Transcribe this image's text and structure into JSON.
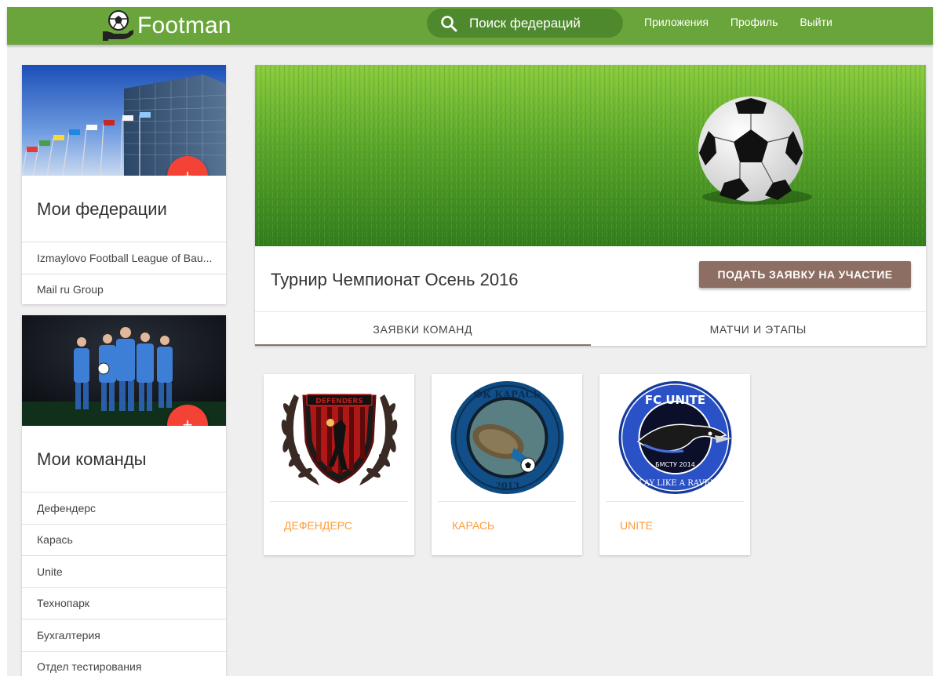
{
  "app": {
    "name": "Footman"
  },
  "header": {
    "search_placeholder": "Поиск федераций",
    "nav": [
      "Приложения",
      "Профиль",
      "Выйти"
    ]
  },
  "federations": {
    "title": "Мои федерации",
    "items": [
      "Izmaylovo Football League of Bau...",
      "Mail ru Group"
    ],
    "add_label": "+"
  },
  "teams": {
    "title": "Мои команды",
    "items": [
      "Дефендерс",
      "Карась",
      "Unite",
      "Технопарк",
      "Бухгалтерия",
      "Отдел тестирования"
    ],
    "add_label": "+"
  },
  "tournament": {
    "title": "Турнир Чемпионат Осень 2016",
    "apply_label": "ПОДАТЬ ЗАЯВКУ НА УЧАСТИЕ",
    "tabs": [
      "ЗАЯВКИ КОМАНД",
      "МАТЧИ И ЭТАПЫ"
    ],
    "active_tab": 0
  },
  "team_tiles": [
    {
      "name": "ДЕФЕНДЕРС",
      "logo_text": "DEFENDERS"
    },
    {
      "name": "КАРАСЬ",
      "logo_top": "ФК КАРАСЬ",
      "logo_bottom": "2013"
    },
    {
      "name": "UNITE",
      "logo_top": "FC UNITE",
      "logo_bottom": "PLAY LIKE A RAVEN",
      "logo_mid": "БМСТУ 2014"
    }
  ],
  "colors": {
    "header": "#6aa53c",
    "search_bg": "#4e8a2d",
    "fab": "#f44336",
    "button": "#8d6e63",
    "team_name": "#ff9e3a"
  }
}
